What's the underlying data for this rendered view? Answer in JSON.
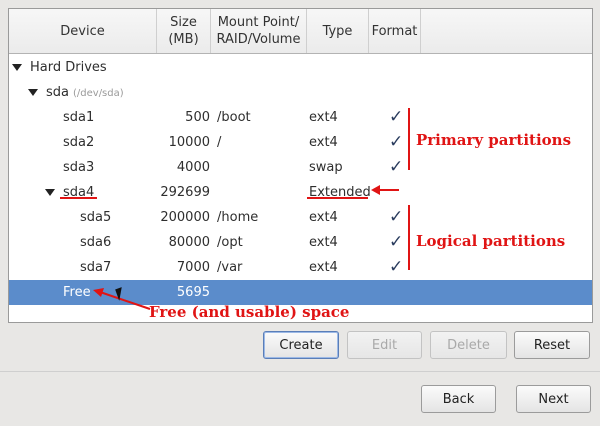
{
  "columns": {
    "device": "Device",
    "size": "Size\n(MB)",
    "mount": "Mount Point/\nRAID/Volume",
    "type": "Type",
    "format": "Format"
  },
  "tree": {
    "root_label": "Hard Drives",
    "disk_label": "sda",
    "disk_path": "(/dev/sda)"
  },
  "rows": [
    {
      "device": "sda1",
      "size": "500",
      "mount": "/boot",
      "type": "ext4",
      "format": "✓"
    },
    {
      "device": "sda2",
      "size": "10000",
      "mount": "/",
      "type": "ext4",
      "format": "✓"
    },
    {
      "device": "sda3",
      "size": "4000",
      "mount": "",
      "type": "swap",
      "format": "✓"
    },
    {
      "device": "sda4",
      "size": "292699",
      "mount": "",
      "type": "Extended",
      "format": ""
    },
    {
      "device": "sda5",
      "size": "200000",
      "mount": "/home",
      "type": "ext4",
      "format": "✓"
    },
    {
      "device": "sda6",
      "size": "80000",
      "mount": "/opt",
      "type": "ext4",
      "format": "✓"
    },
    {
      "device": "sda7",
      "size": "7000",
      "mount": "/var",
      "type": "ext4",
      "format": "✓"
    },
    {
      "device": "Free",
      "size": "5695",
      "mount": "",
      "type": "",
      "format": ""
    }
  ],
  "annotations": {
    "primary": "Primary partitions",
    "logical": "Logical partitions",
    "free": "Free (and usable) space"
  },
  "buttons": {
    "create": "Create",
    "edit": "Edit",
    "delete": "Delete",
    "reset": "Reset",
    "back": "Back",
    "next": "Next"
  },
  "colors": {
    "annotation": "#e01414",
    "selection": "#5b8ccb"
  }
}
